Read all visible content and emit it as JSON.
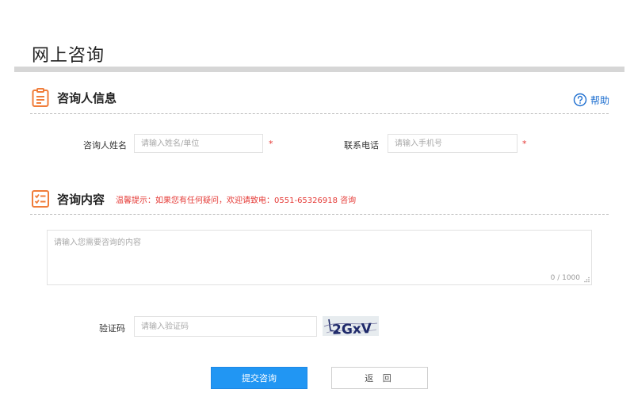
{
  "page": {
    "title": "网上咨询"
  },
  "sections": {
    "info": {
      "title": "咨询人信息",
      "help_label": "帮助"
    },
    "content": {
      "title": "咨询内容",
      "tip": "温馨提示：如果您有任何疑问，欢迎请致电：0551-65326918 咨询"
    }
  },
  "form": {
    "name": {
      "label": "咨询人姓名",
      "placeholder": "请输入姓名/单位",
      "required_mark": "*"
    },
    "phone": {
      "label": "联系电话",
      "placeholder": "请输入手机号",
      "required_mark": "*"
    },
    "content": {
      "placeholder": "请输入您需要咨询的内容",
      "counter": "0 / 1000"
    },
    "captcha": {
      "label": "验证码",
      "placeholder": "请输入验证码",
      "image_text": "2GxV"
    }
  },
  "buttons": {
    "submit": "提交咨询",
    "back": "返 回"
  },
  "colors": {
    "accent_orange": "#f07d3a",
    "primary_blue": "#2196f3",
    "tip_red": "#e53935",
    "link_blue": "#1e6fd0"
  },
  "icons": {
    "info_section": "clipboard-icon",
    "content_section": "checklist-icon",
    "help": "question-circle-icon"
  }
}
